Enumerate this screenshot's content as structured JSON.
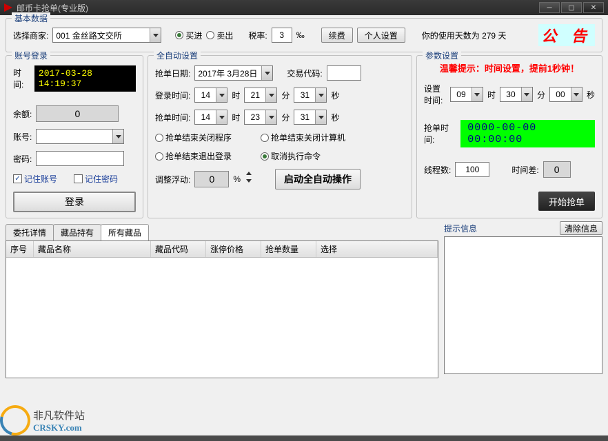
{
  "window": {
    "title": "邮币卡抢单(专业版)"
  },
  "basic": {
    "legend": "基本数据",
    "merchant_label": "选择商家:",
    "merchant_value": "001 金丝路文交所",
    "buy": "买进",
    "sell": "卖出",
    "rate_label": "税率:",
    "rate_value": "3",
    "rate_pct": "‰",
    "renew": "续费",
    "profile": "个人设置",
    "usage": "你的使用天数为 279 天",
    "announce": "公 告"
  },
  "login": {
    "legend": "账号登录",
    "time_label": "时间:",
    "time_value": "2017-03-28 14:19:37",
    "balance_label": "余额:",
    "balance_value": "0",
    "acct_label": "账号:",
    "pwd_label": "密码:",
    "remember_acct": "记住账号",
    "remember_pwd": "记住密码",
    "login_btn": "登录"
  },
  "auto": {
    "legend": "全自动设置",
    "date_label": "抢单日期:",
    "date_value": "2017年 3月28日",
    "code_label": "交易代码:",
    "login_time_label": "登录时间:",
    "grab_time_label": "抢单时间:",
    "h": "时",
    "m": "分",
    "s": "秒",
    "login_h": "14",
    "login_m": "21",
    "login_s": "31",
    "grab_h": "14",
    "grab_m": "23",
    "grab_s": "31",
    "end_close_prog": "抢单结束关闭程序",
    "end_close_pc": "抢单结束关闭计算机",
    "end_logout": "抢单结束退出登录",
    "cancel_cmd": "取消执行命令",
    "float_label": "调整浮动:",
    "float_value": "0",
    "float_pct": "%",
    "start_auto": "启动全自动操作"
  },
  "param": {
    "legend": "参数设置",
    "warm": "温馨提示：时间设置，提前1秒钟！",
    "set_time_label": "设置时间:",
    "set_h": "09",
    "set_m": "30",
    "set_s": "00",
    "grab_label": "抢单时间:",
    "grab_display": "0000-00-00 00:00:00",
    "threads_label": "线程数:",
    "threads": "100",
    "diff_label": "时间差:",
    "diff": "0",
    "start_grab": "开始抢单"
  },
  "tabs": {
    "t1": "委托详情",
    "t2": "藏品持有",
    "t3": "所有藏品"
  },
  "grid": {
    "c1": "序号",
    "c2": "藏品名称",
    "c3": "藏品代码",
    "c4": "涨停价格",
    "c5": "抢单数量",
    "c6": "选择"
  },
  "hint": {
    "legend": "提示信息",
    "clear": "清除信息"
  },
  "logo": {
    "cn": "非凡软件站",
    "en": "CRSKY.com"
  }
}
